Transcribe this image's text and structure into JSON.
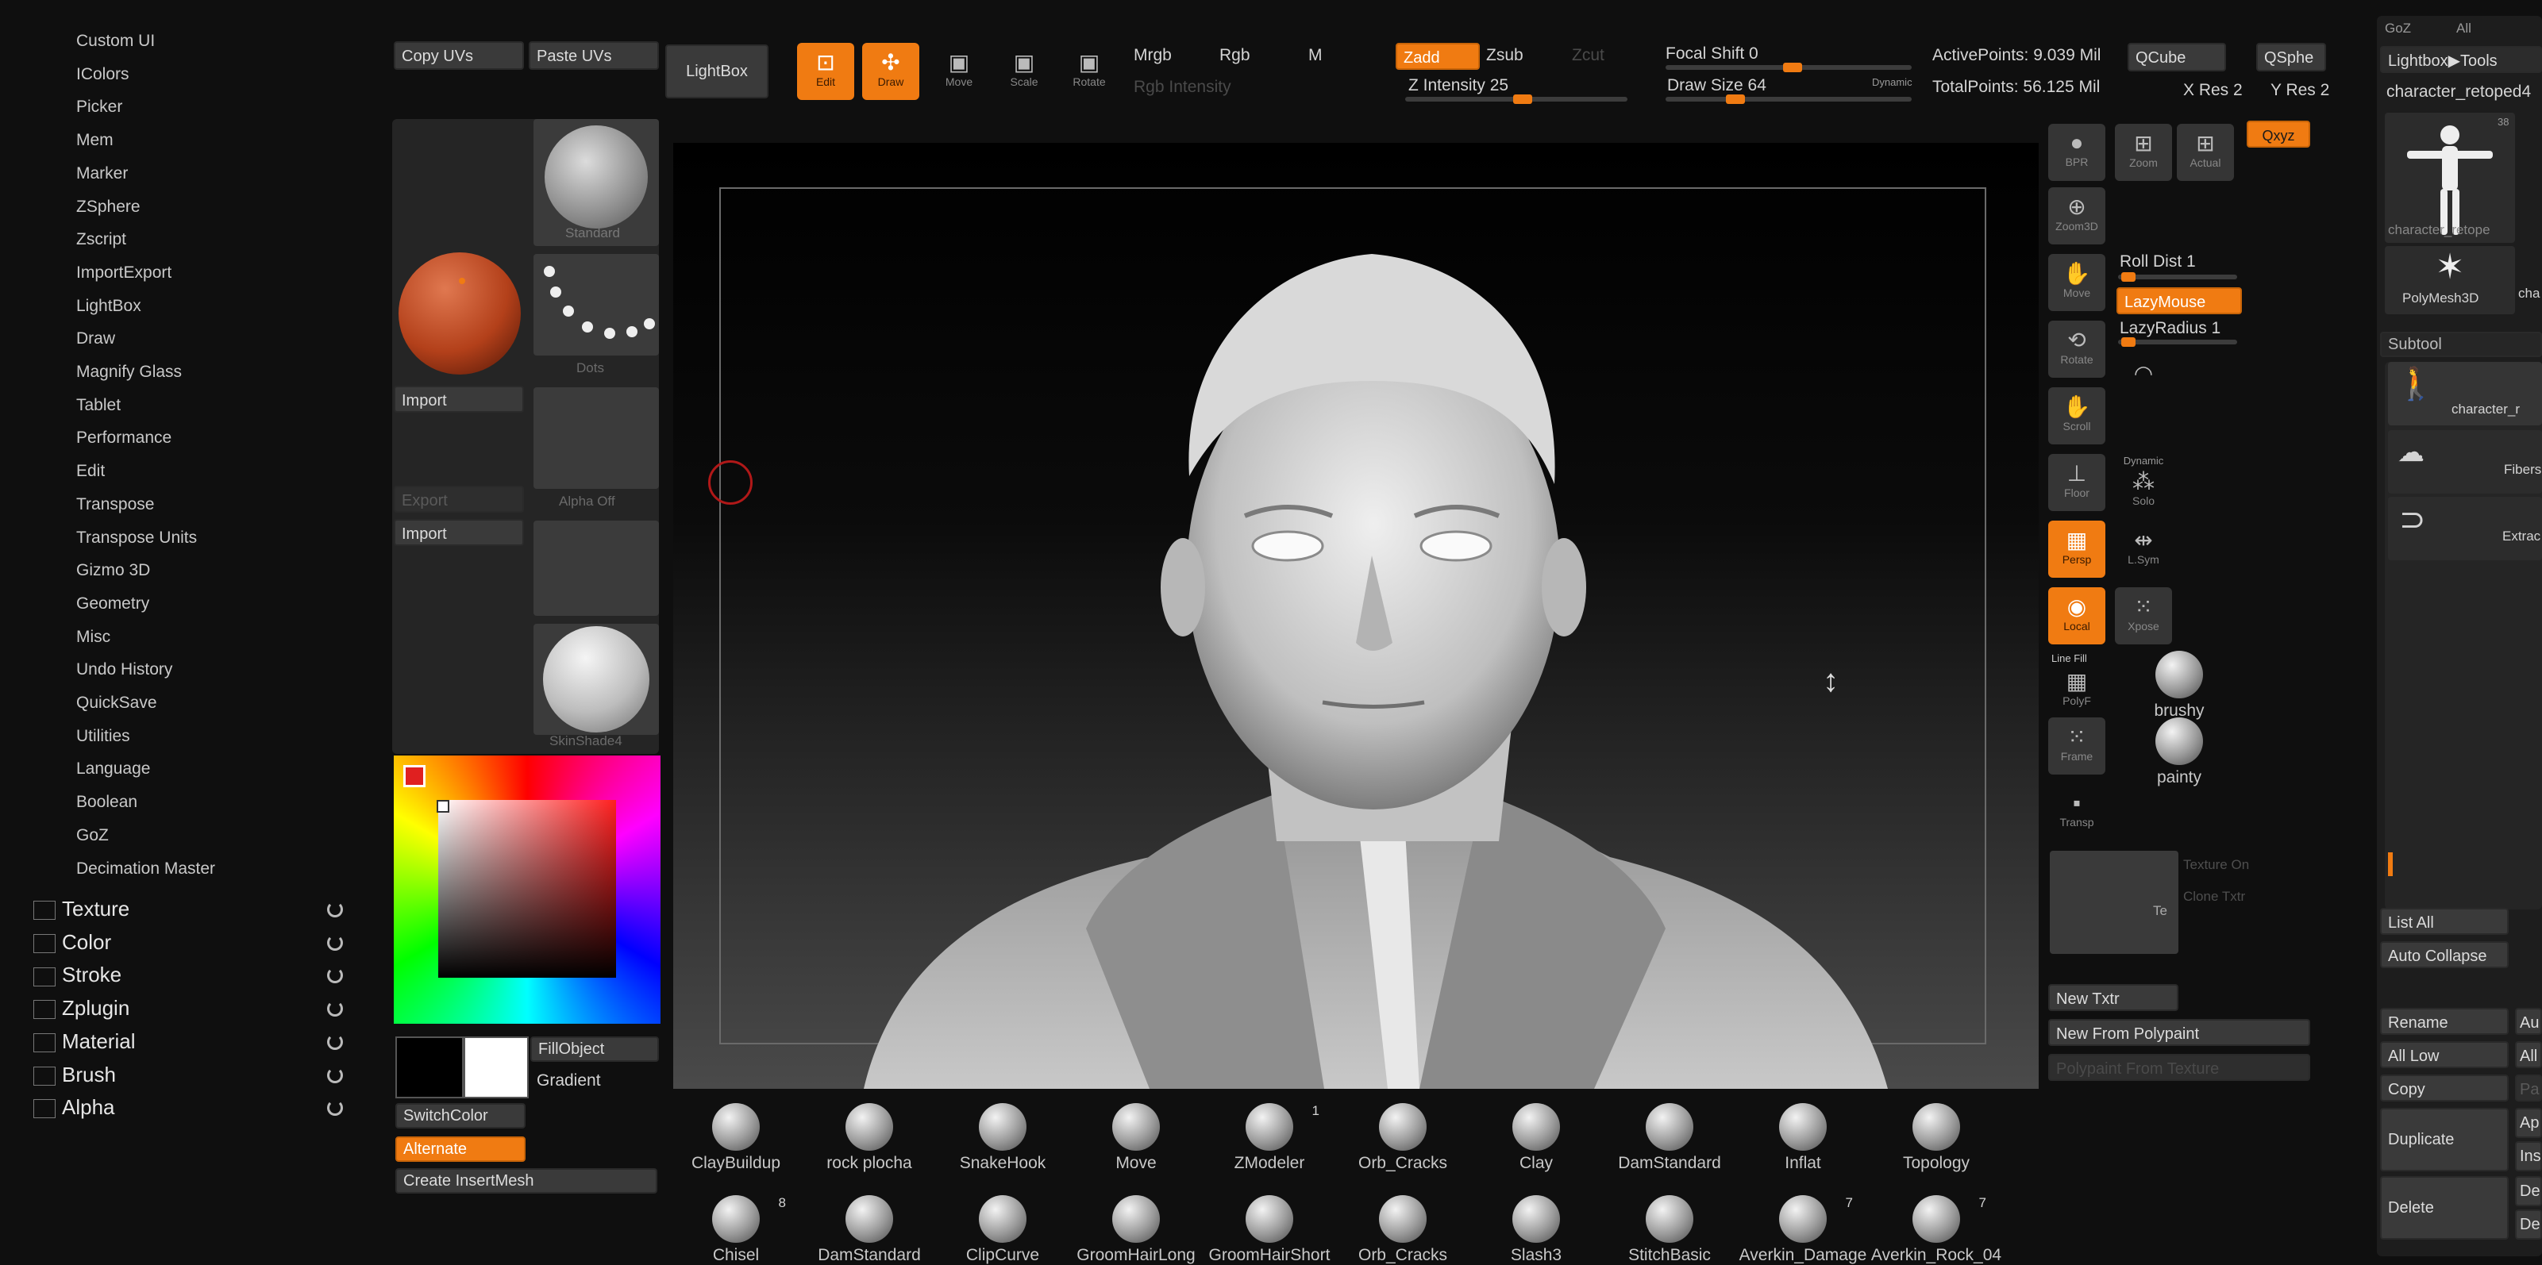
{
  "menu": {
    "items": [
      "Custom UI",
      "IColors",
      "Picker",
      "Mem",
      "Marker",
      "ZSphere",
      "Zscript",
      "ImportExport",
      "LightBox",
      "Draw",
      "Magnify Glass",
      "Tablet",
      "Performance",
      "Edit",
      "Transpose",
      "Transpose Units",
      "Gizmo 3D",
      "Geometry",
      "Misc",
      "Undo History",
      "QuickSave",
      "Utilities",
      "Language",
      "Boolean",
      "GoZ",
      "Decimation Master"
    ],
    "palettes": [
      {
        "label": "Texture",
        "icon": "texture-icon"
      },
      {
        "label": "Color",
        "icon": "color-icon"
      },
      {
        "label": "Stroke",
        "icon": "stroke-icon"
      },
      {
        "label": "Zplugin",
        "icon": "zplugin-icon"
      },
      {
        "label": "Material",
        "icon": "material-icon"
      },
      {
        "label": "Brush",
        "icon": "brush-icon"
      },
      {
        "label": "Alpha",
        "icon": "alpha-icon"
      }
    ]
  },
  "shelf": {
    "copy_uvs": "Copy UVs",
    "paste_uvs": "Paste UVs",
    "standard": "Standard",
    "dots": "Dots",
    "import_1": "Import",
    "import_2": "Import",
    "export": "Export",
    "alpha_off": "Alpha Off",
    "skinshade": "SkinShade4",
    "fill_object": "FillObject",
    "gradient": "Gradient",
    "switch_color": "SwitchColor",
    "alternate": "Alternate",
    "create_insert_mesh": "Create InsertMesh"
  },
  "top": {
    "lightbox": "LightBox",
    "edit": "Edit",
    "draw": "Draw",
    "move": "Move",
    "scale": "Scale",
    "rotate": "Rotate",
    "mrgb": "Mrgb",
    "rgb": "Rgb",
    "m": "M",
    "rgb_intensity": "Rgb Intensity",
    "zadd": "Zadd",
    "zsub": "Zsub",
    "zcut": "Zcut",
    "z_intensity": "Z Intensity 25",
    "focal_shift": "Focal Shift 0",
    "draw_size": "Draw Size 64",
    "dynamic": "Dynamic",
    "active_points": "ActivePoints: 9.039 Mil",
    "total_points": "TotalPoints: 56.125 Mil",
    "qcube": "QCube",
    "qsphere": "QSphe",
    "xres": "X Res 2",
    "yres": "Y Res 2"
  },
  "right_tools": {
    "bpr": "BPR",
    "zoom3d": "Zoom3D",
    "move": "Move",
    "rotate": "Rotate",
    "scroll": "Scroll",
    "floor": "Floor",
    "persp": "Persp",
    "dynamic": "Dynamic",
    "local": "Local",
    "line_fill": "Line Fill",
    "polyf": "PolyF",
    "frame": "Frame",
    "transp": "Transp",
    "zoom": "Zoom",
    "actual": "Actual",
    "xyz": "Qxyz",
    "roll_dist": "Roll Dist 1",
    "lazy_mouse": "LazyMouse",
    "lazy_radius": "LazyRadius 1",
    "solo": "Solo",
    "lsym": "L.Sym",
    "xpose": "Xpose",
    "brushy": "brushy",
    "painty": "painty",
    "texture_on": "Texture On",
    "clone_txtr": "Clone Txtr",
    "te": "Te",
    "new_txtr": "New Txtr",
    "new_from_polypaint": "New From Polypaint",
    "polypaint_from_texture": "Polypaint From Texture"
  },
  "tool_panel": {
    "goz": "GoZ",
    "all": "All",
    "lightbox_tools": "Lightbox▶Tools",
    "tool_name": "character_retoped4",
    "thumb_count": "38",
    "thumb_label": "character_retope",
    "polymesh": "PolyMesh3D",
    "cha": "cha",
    "subtool": "Subtool",
    "subtool_1": "character_r",
    "subtool_2": "Fibers",
    "subtool_3": "Extrac",
    "list_all": "List All",
    "auto_collapse": "Auto Collapse",
    "rename": "Rename",
    "all_low": "All Low",
    "copy": "Copy",
    "duplicate": "Duplicate",
    "delete": "Delete",
    "au": "Au",
    "all_r": "All",
    "pa": "Pa",
    "ap": "Ap",
    "ins": "Ins",
    "de1": "De",
    "de2": "De"
  },
  "brushes_row1": [
    {
      "label": "ClayBuildup",
      "count": ""
    },
    {
      "label": "rock plocha",
      "count": ""
    },
    {
      "label": "SnakeHook",
      "count": ""
    },
    {
      "label": "Move",
      "count": ""
    },
    {
      "label": "ZModeler",
      "count": "1"
    },
    {
      "label": "Orb_Cracks",
      "count": ""
    },
    {
      "label": "Clay",
      "count": ""
    },
    {
      "label": "DamStandard",
      "count": ""
    },
    {
      "label": "Inflat",
      "count": ""
    },
    {
      "label": "Topology",
      "count": ""
    }
  ],
  "brushes_row2": [
    {
      "label": "Chisel",
      "count": "8"
    },
    {
      "label": "DamStandard",
      "count": ""
    },
    {
      "label": "ClipCurve",
      "count": ""
    },
    {
      "label": "GroomHairLong",
      "count": ""
    },
    {
      "label": "GroomHairShort",
      "count": ""
    },
    {
      "label": "Orb_Cracks",
      "count": ""
    },
    {
      "label": "Slash3",
      "count": ""
    },
    {
      "label": "StitchBasic",
      "count": ""
    },
    {
      "label": "Averkin_Damage",
      "count": "7"
    },
    {
      "label": "Averkin_Rock_04",
      "count": "7"
    }
  ],
  "colors": {
    "accent": "#f07b12",
    "background": "#0f0f0f",
    "panel": "#2b2b2b",
    "main_color": "#000000",
    "secondary_color": "#ffffff"
  }
}
